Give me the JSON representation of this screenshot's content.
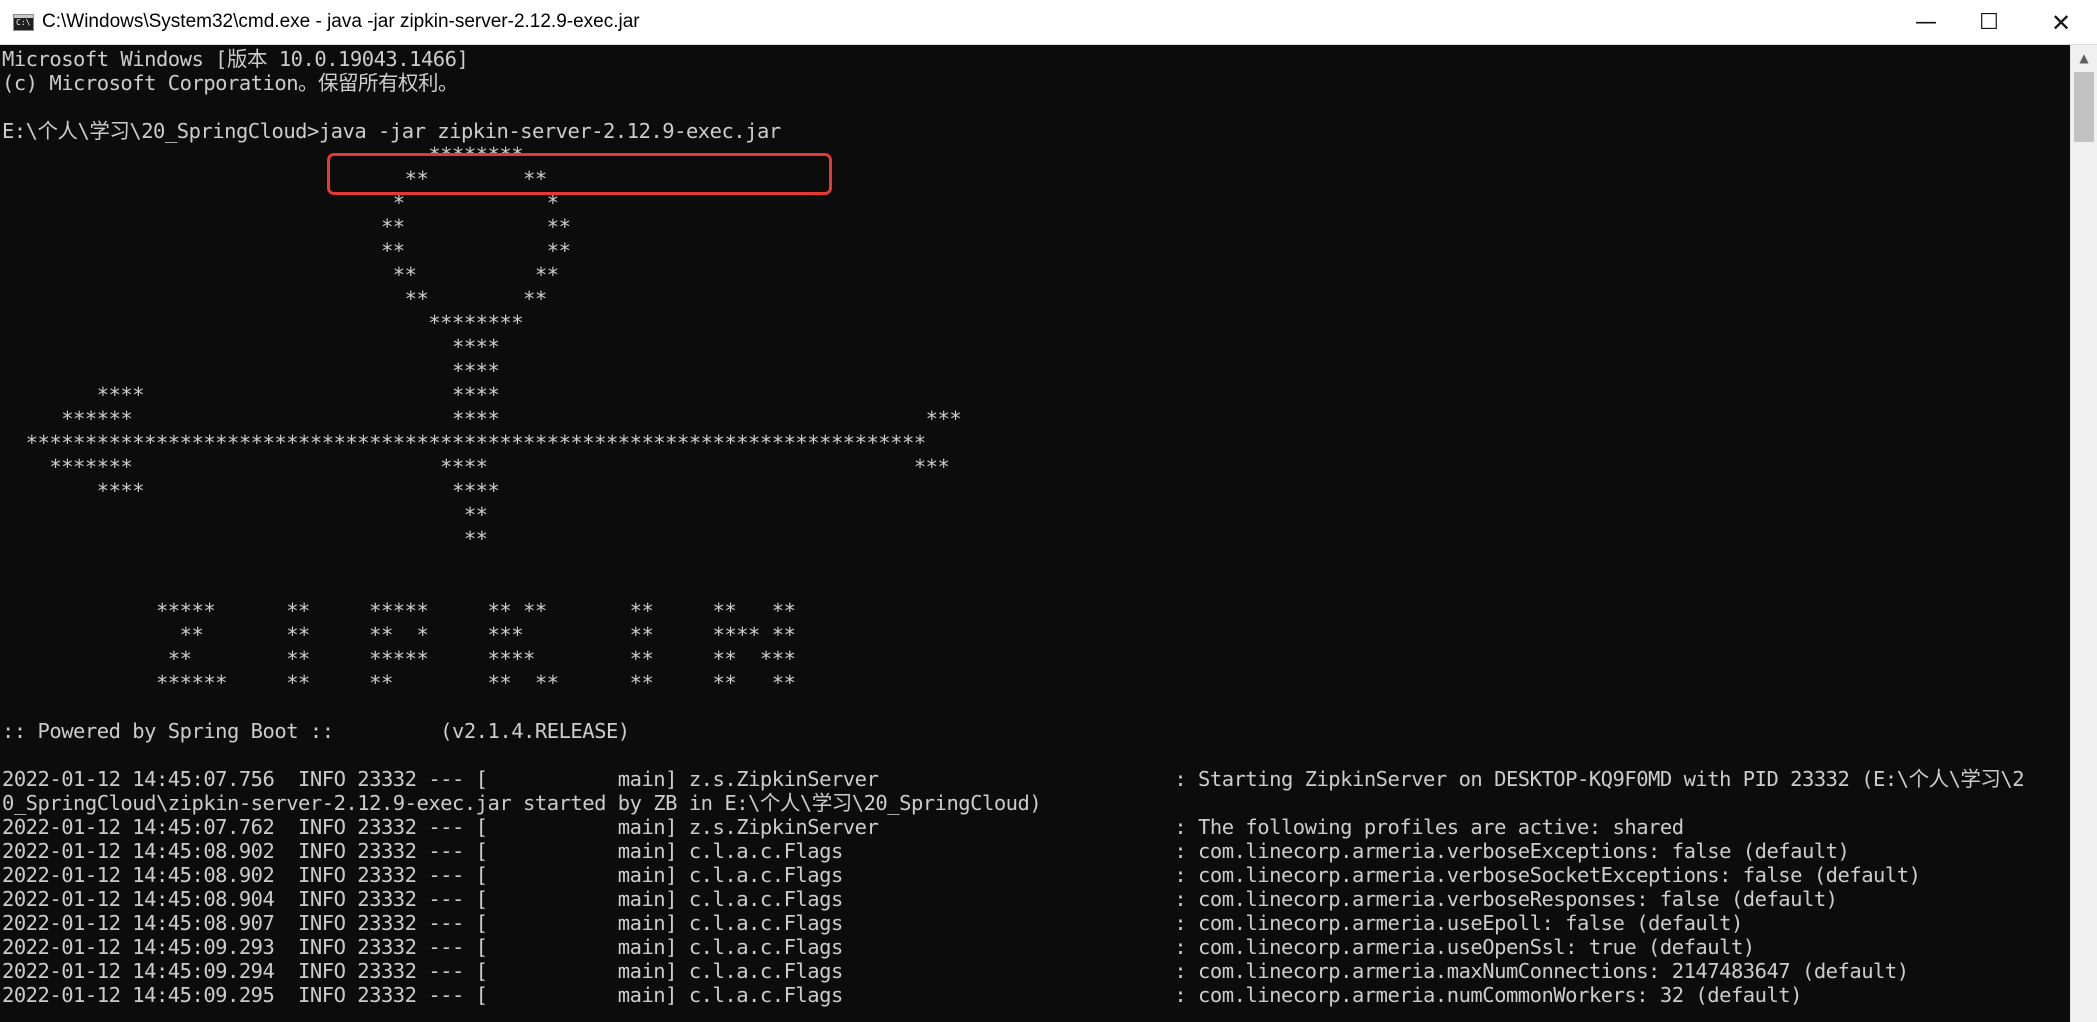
{
  "window": {
    "title": "C:\\Windows\\System32\\cmd.exe - java  -jar zipkin-server-2.12.9-exec.jar",
    "icon_text": "C:\\",
    "minimize_glyph": "—",
    "maximize_glyph": "☐",
    "close_glyph": "✕"
  },
  "scrollbar": {
    "up_glyph": "▲"
  },
  "console": {
    "lines": [
      "Microsoft Windows [版本 10.0.19043.1466]",
      "(c) Microsoft Corporation。保留所有权利。",
      "",
      "E:\\个人\\学习\\20_SpringCloud>java -jar zipkin-server-2.12.9-exec.jar",
      "                                    ********",
      "                                  **        **",
      "                                 *            *",
      "                                **            **",
      "                                **            **",
      "                                 **          **",
      "                                  **        **",
      "                                    ********",
      "                                      ****",
      "                                      ****",
      "        ****                          ****",
      "     ******                           ****                                    ***",
      "  ****************************************************************************",
      "    *******                          ****                                    ***",
      "        ****                          ****",
      "                                       **",
      "                                       **",
      "",
      "",
      "             *****      **     *****     ** **       **     **   **",
      "               **       **     **  *     ***         **     **** **",
      "              **        **     *****     ****        **     **  ***",
      "             ******     **     **        **  **      **     **   **",
      "",
      ":: Powered by Spring Boot ::         (v2.1.4.RELEASE)",
      "",
      "2022-01-12 14:45:07.756  INFO 23332 --- [           main] z.s.ZipkinServer                         : Starting ZipkinServer on DESKTOP-KQ9F0MD with PID 23332 (E:\\个人\\学习\\2",
      "0_SpringCloud\\zipkin-server-2.12.9-exec.jar started by ZB in E:\\个人\\学习\\20_SpringCloud)",
      "2022-01-12 14:45:07.762  INFO 23332 --- [           main] z.s.ZipkinServer                         : The following profiles are active: shared",
      "2022-01-12 14:45:08.902  INFO 23332 --- [           main] c.l.a.c.Flags                            : com.linecorp.armeria.verboseExceptions: false (default)",
      "2022-01-12 14:45:08.902  INFO 23332 --- [           main] c.l.a.c.Flags                            : com.linecorp.armeria.verboseSocketExceptions: false (default)",
      "2022-01-12 14:45:08.904  INFO 23332 --- [           main] c.l.a.c.Flags                            : com.linecorp.armeria.verboseResponses: false (default)",
      "2022-01-12 14:45:08.907  INFO 23332 --- [           main] c.l.a.c.Flags                            : com.linecorp.armeria.useEpoll: false (default)",
      "2022-01-12 14:45:09.293  INFO 23332 --- [           main] c.l.a.c.Flags                            : com.linecorp.armeria.useOpenSsl: true (default)",
      "2022-01-12 14:45:09.294  INFO 23332 --- [           main] c.l.a.c.Flags                            : com.linecorp.armeria.maxNumConnections: 2147483647 (default)",
      "2022-01-12 14:45:09.295  INFO 23332 --- [           main] c.l.a.c.Flags                            : com.linecorp.armeria.numCommonWorkers: 32 (default)"
    ]
  },
  "colors": {
    "console_background": "#0c0c0c",
    "console_text": "#cccccc",
    "highlight_border": "#e53935",
    "titlebar_background": "#ffffff"
  }
}
